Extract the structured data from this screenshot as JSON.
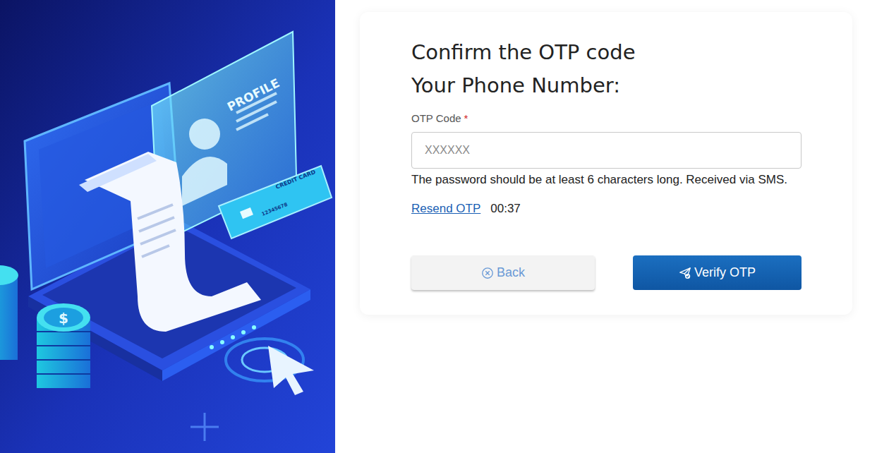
{
  "illustration": {
    "profile_label": "PROFILE",
    "card_label": "CREDIT CARD",
    "card_number": "12345678",
    "coin_symbol": "$"
  },
  "form": {
    "title": "Confirm the OTP code",
    "subtitle": "Your Phone Number:",
    "field": {
      "label": "OTP Code",
      "required_mark": "*",
      "placeholder": "XXXXXX",
      "value": "",
      "hint": "The password should be at least 6 characters long. Received via SMS."
    },
    "resend": {
      "label": "Resend OTP",
      "timer": "00:37"
    }
  },
  "buttons": [
    {
      "label": "Back",
      "kind": "secondary"
    },
    {
      "label": "Verify OTP",
      "kind": "primary"
    }
  ]
}
